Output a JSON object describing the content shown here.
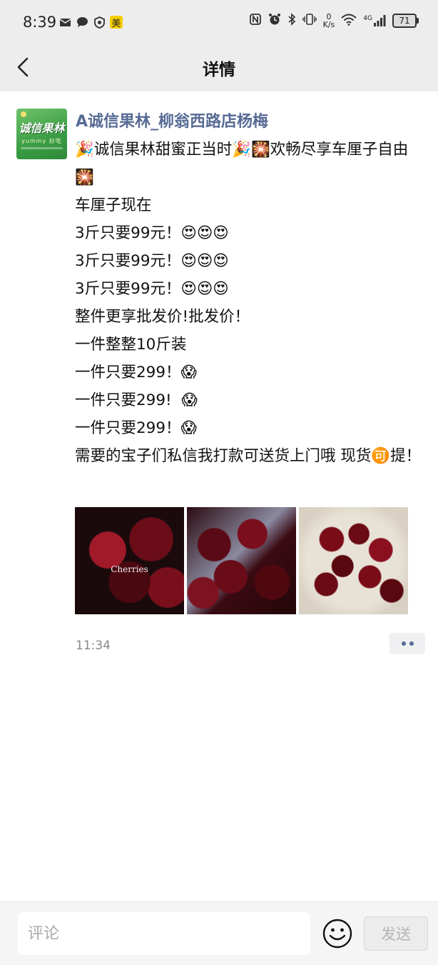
{
  "status_bar": {
    "time": "8:39",
    "left_icons": [
      "mail-icon",
      "chat-bubble-icon",
      "app-shield-icon",
      "meituan-badge-icon"
    ],
    "meituan_badge": "美",
    "net_speed_value": "0",
    "net_speed_unit": "K/s",
    "signal_label": "4G",
    "battery": "71"
  },
  "nav": {
    "title": "详情"
  },
  "post": {
    "author": "A诚信果林_柳翁西路店杨梅",
    "avatar_text": "诚信果林",
    "avatar_subtext": "yummy 好吃",
    "lines": [
      "🎉诚信果林甜蜜正当时🎉🎇欢畅尽享车厘子自由🎇",
      "车厘子现在",
      "3斤只要99元！😍😍😍",
      "3斤只要99元！😍😍😍",
      "3斤只要99元！😍😍😍",
      "整件更享批发价!批发价！",
      "一件整整10斤装",
      "一件只要299！😱",
      "一件只要299!  😱",
      "一件只要299！😱",
      "需要的宝子们私信我打款可送货上门哦 现货🉑提！"
    ],
    "image_caption": "Cherries",
    "time": "11:34"
  },
  "comment_bar": {
    "placeholder": "评论",
    "send_label": "发送"
  },
  "colors": {
    "link_blue": "#576b95",
    "header_bg": "#ededed",
    "time_gray": "#888888"
  }
}
